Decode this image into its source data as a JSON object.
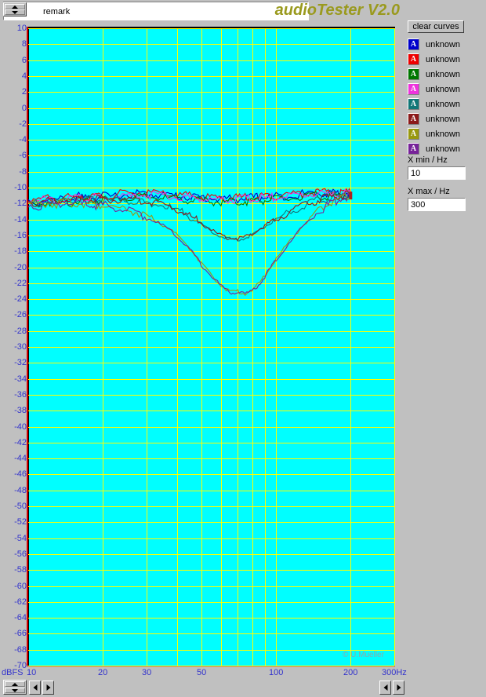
{
  "window": {
    "app_title": "audioTester V2.0",
    "background_color": "#c0c0c0"
  },
  "toolbar": {
    "remark_value": "remark",
    "remark_placeholder": "remark",
    "spinner_up_icon": "triangle-up-icon",
    "spinner_down_icon": "triangle-down-icon"
  },
  "right_panel": {
    "clear_curves_label": "clear curves",
    "legend": [
      {
        "label": "unknown",
        "color": "#0000cc",
        "glyph": "A"
      },
      {
        "label": "unknown",
        "color": "#ee0000",
        "glyph": "A"
      },
      {
        "label": "unknown",
        "color": "#007700",
        "glyph": "A"
      },
      {
        "label": "unknown",
        "color": "#ee33dd",
        "glyph": "A"
      },
      {
        "label": "unknown",
        "color": "#117777",
        "glyph": "A"
      },
      {
        "label": "unknown",
        "color": "#8b1a1a",
        "glyph": "A"
      },
      {
        "label": "unknown",
        "color": "#999911",
        "glyph": "A"
      },
      {
        "label": "unknown",
        "color": "#772299",
        "glyph": "A"
      }
    ],
    "x_min_label": "X min / Hz",
    "x_min_value": "10",
    "x_max_label": "X max / Hz",
    "x_max_value": "300"
  },
  "footer": {
    "copyright": "© U.Mueller",
    "left_arrow_icon": "arrow-left-icon",
    "right_arrow_icon": "arrow-right-icon"
  },
  "chart_data": {
    "type": "line",
    "title": "audioTester V2.0",
    "xlabel": "Hz",
    "ylabel": "dBFS",
    "xscale": "log",
    "xlim": [
      10,
      300
    ],
    "ylim": [
      -70,
      10
    ],
    "ytick_step": 2,
    "grid": true,
    "legend_position": "right",
    "plot_bg": "#00ffff",
    "grid_color": "#ffff00",
    "axis_label_color": "#3333cc",
    "xticks": [
      10,
      20,
      30,
      50,
      100,
      200,
      300
    ],
    "xtick_labels": [
      "10",
      "20",
      "30",
      "50",
      "100",
      "200",
      "300Hz"
    ],
    "xgridlines": [
      20,
      30,
      40,
      50,
      60,
      70,
      80,
      90,
      100,
      200
    ],
    "yticks": [
      10,
      8,
      6,
      4,
      2,
      0,
      -2,
      -4,
      -6,
      -8,
      -10,
      -12,
      -14,
      -16,
      -18,
      -20,
      -22,
      -24,
      -26,
      -28,
      -30,
      -32,
      -34,
      -36,
      -38,
      -40,
      -42,
      -44,
      -46,
      -48,
      -50,
      -52,
      -54,
      -56,
      -58,
      -60,
      -62,
      -64,
      -66,
      -68,
      -70
    ],
    "x": [
      10,
      11,
      12,
      13,
      14,
      15,
      16,
      17,
      18,
      19,
      20,
      22,
      24,
      26,
      28,
      30,
      32,
      35,
      38,
      41,
      44,
      47,
      50,
      54,
      58,
      62,
      66,
      70,
      75,
      80,
      85,
      90,
      95,
      100,
      110,
      120,
      130,
      140,
      150,
      160,
      170,
      180,
      190,
      200
    ],
    "series": [
      {
        "name": "unknown",
        "color": "#0000cc",
        "values": [
          -11.6,
          -11.9,
          -11.3,
          -11.8,
          -11.2,
          -11.5,
          -11.1,
          -11.4,
          -11.0,
          -11.3,
          -11.0,
          -11.2,
          -10.8,
          -11.0,
          -10.7,
          -10.9,
          -10.8,
          -10.9,
          -11.0,
          -11.1,
          -11.1,
          -11.2,
          -11.3,
          -11.3,
          -11.4,
          -11.4,
          -11.4,
          -11.4,
          -11.3,
          -11.3,
          -11.2,
          -11.2,
          -11.1,
          -11.1,
          -11.0,
          -10.9,
          -10.8,
          -10.7,
          -10.6,
          -10.8,
          -10.5,
          -10.9,
          -10.6,
          -10.8
        ]
      },
      {
        "name": "unknown",
        "color": "#ee0000",
        "values": [
          -11.4,
          -11.8,
          -11.2,
          -11.6,
          -11.1,
          -11.4,
          -11.0,
          -11.3,
          -10.9,
          -11.2,
          -10.9,
          -11.1,
          -10.7,
          -10.9,
          -10.6,
          -10.8,
          -10.7,
          -10.8,
          -10.9,
          -11.0,
          -11.0,
          -11.1,
          -11.2,
          -11.2,
          -11.3,
          -11.3,
          -11.3,
          -11.3,
          -11.2,
          -11.2,
          -11.1,
          -11.1,
          -11.0,
          -11.0,
          -10.9,
          -10.8,
          -10.7,
          -10.6,
          -10.5,
          -10.7,
          -10.4,
          -10.8,
          -10.5,
          -10.7
        ]
      },
      {
        "name": "unknown",
        "color": "#007700",
        "values": [
          -11.9,
          -12.2,
          -11.7,
          -12.1,
          -11.6,
          -11.9,
          -11.5,
          -11.8,
          -11.4,
          -11.7,
          -11.4,
          -11.6,
          -11.2,
          -11.4,
          -11.1,
          -11.3,
          -11.2,
          -11.3,
          -11.4,
          -11.5,
          -11.5,
          -11.6,
          -11.7,
          -11.7,
          -11.8,
          -11.8,
          -11.8,
          -11.8,
          -11.7,
          -11.7,
          -11.6,
          -11.6,
          -11.5,
          -11.5,
          -11.4,
          -11.3,
          -11.2,
          -11.1,
          -11.0,
          -11.2,
          -10.9,
          -11.3,
          -11.0,
          -11.1
        ]
      },
      {
        "name": "unknown",
        "color": "#ee33dd",
        "values": [
          -11.5,
          -11.7,
          -11.4,
          -11.7,
          -11.3,
          -11.5,
          -11.2,
          -11.4,
          -11.1,
          -11.3,
          -11.1,
          -11.2,
          -10.9,
          -11.1,
          -10.8,
          -11.0,
          -10.9,
          -11.0,
          -11.1,
          -11.2,
          -11.2,
          -11.3,
          -11.4,
          -11.4,
          -11.5,
          -11.5,
          -11.5,
          -11.5,
          -11.4,
          -11.4,
          -11.3,
          -11.3,
          -11.2,
          -11.2,
          -11.1,
          -11.0,
          -10.9,
          -10.8,
          -10.7,
          -10.9,
          -10.6,
          -11.0,
          -10.7,
          -10.9
        ]
      },
      {
        "name": "unknown",
        "color": "#117777",
        "values": [
          -11.8,
          -12.0,
          -11.7,
          -12.0,
          -11.6,
          -11.8,
          -11.5,
          -11.7,
          -11.5,
          -11.6,
          -11.5,
          -11.7,
          -11.6,
          -11.8,
          -11.7,
          -11.9,
          -12.0,
          -12.3,
          -12.6,
          -13.0,
          -13.5,
          -14.0,
          -14.6,
          -15.3,
          -15.9,
          -16.3,
          -16.5,
          -16.5,
          -16.3,
          -15.9,
          -15.4,
          -14.9,
          -14.4,
          -14.0,
          -13.3,
          -12.7,
          -12.3,
          -11.9,
          -11.6,
          -11.4,
          -11.2,
          -11.1,
          -11.0,
          -11.0
        ]
      },
      {
        "name": "unknown",
        "color": "#8b1a1a",
        "values": [
          -11.7,
          -11.9,
          -11.6,
          -11.9,
          -11.5,
          -11.7,
          -11.4,
          -11.6,
          -11.4,
          -11.5,
          -11.4,
          -11.6,
          -11.5,
          -11.7,
          -11.6,
          -11.8,
          -11.9,
          -12.2,
          -12.5,
          -12.9,
          -13.4,
          -13.9,
          -14.5,
          -15.2,
          -15.8,
          -16.2,
          -16.4,
          -16.4,
          -16.2,
          -15.8,
          -15.3,
          -14.8,
          -14.3,
          -13.9,
          -13.2,
          -12.6,
          -12.2,
          -11.8,
          -11.5,
          -11.3,
          -11.1,
          -11.0,
          -10.9,
          -10.9
        ]
      },
      {
        "name": "unknown",
        "color": "#999911",
        "values": [
          -12.0,
          -12.2,
          -11.9,
          -12.1,
          -11.8,
          -12.0,
          -11.9,
          -12.1,
          -12.0,
          -12.2,
          -12.1,
          -12.4,
          -12.6,
          -12.9,
          -13.2,
          -13.6,
          -14.0,
          -14.7,
          -15.4,
          -16.3,
          -17.3,
          -18.4,
          -19.6,
          -20.8,
          -21.8,
          -22.6,
          -23.1,
          -23.0,
          -23.3,
          -22.9,
          -22.1,
          -21.1,
          -20.0,
          -19.0,
          -17.3,
          -15.8,
          -14.6,
          -13.6,
          -12.8,
          -12.2,
          -11.7,
          -11.4,
          -11.2,
          -11.1
        ]
      },
      {
        "name": "unknown",
        "color": "#772299",
        "values": [
          -12.1,
          -12.3,
          -12.0,
          -12.2,
          -11.9,
          -12.1,
          -12.0,
          -12.2,
          -12.1,
          -12.3,
          -12.2,
          -12.5,
          -12.7,
          -13.0,
          -13.3,
          -13.7,
          -14.1,
          -14.8,
          -15.5,
          -16.4,
          -17.4,
          -18.5,
          -19.7,
          -20.9,
          -21.9,
          -22.7,
          -23.2,
          -23.1,
          -23.4,
          -23.0,
          -22.2,
          -21.2,
          -20.1,
          -19.1,
          -17.4,
          -15.9,
          -14.7,
          -13.7,
          -12.9,
          -12.3,
          -11.8,
          -11.5,
          -11.3,
          -11.2
        ]
      }
    ]
  }
}
